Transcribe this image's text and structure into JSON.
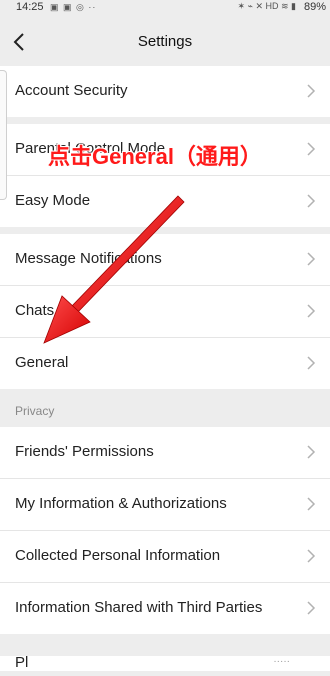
{
  "status_bar": {
    "time": "14:25",
    "left_icons": "▣ ▣ ◎ ··",
    "right_icons": "✶ ⌁ ✕ HD ≋ ▮",
    "battery": "89%"
  },
  "header": {
    "title": "Settings",
    "back_icon": "chevron-left-icon"
  },
  "groups": [
    {
      "items": [
        {
          "label": "Account Security"
        }
      ]
    },
    {
      "items": [
        {
          "label": "Parental Control Mode"
        },
        {
          "label": "Easy Mode"
        }
      ]
    },
    {
      "items": [
        {
          "label": "Message Notifications"
        },
        {
          "label": "Chats"
        },
        {
          "label": "General"
        }
      ]
    },
    {
      "section_label": "Privacy",
      "items": [
        {
          "label": "Friends' Permissions"
        },
        {
          "label": "My Information & Authorizations"
        },
        {
          "label": "Collected Personal Information"
        },
        {
          "label": "Information Shared with Third Parties"
        }
      ]
    }
  ],
  "annotation": {
    "text": "点击General（通用）",
    "color": "#ff1a1a"
  },
  "bottom_partial": {
    "label": "Pl",
    "hint": "·····"
  },
  "colors": {
    "background": "#ededed",
    "row_background": "#ffffff",
    "annotation_red": "#ff1a1a"
  }
}
